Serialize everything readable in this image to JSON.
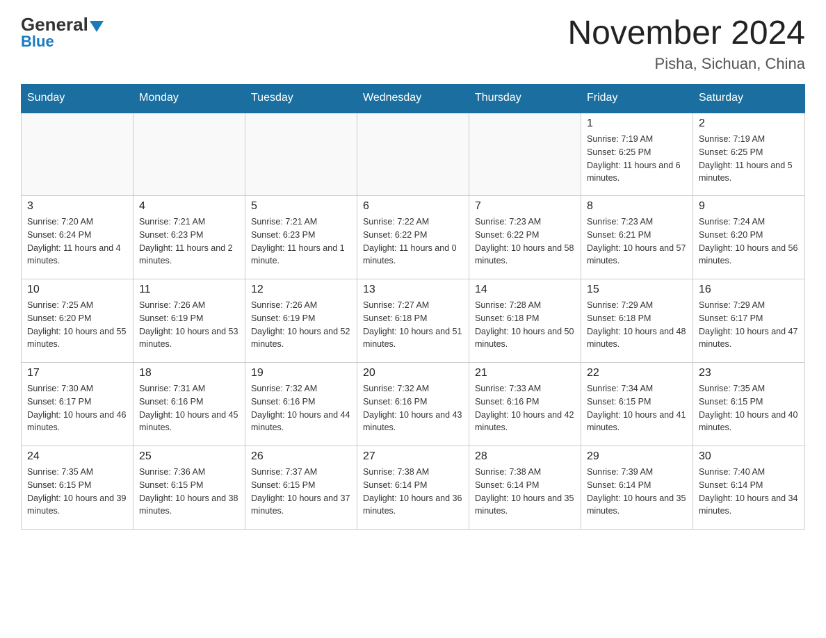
{
  "header": {
    "logo_general": "General",
    "logo_blue": "Blue",
    "title": "November 2024",
    "location": "Pisha, Sichuan, China"
  },
  "days_of_week": [
    "Sunday",
    "Monday",
    "Tuesday",
    "Wednesday",
    "Thursday",
    "Friday",
    "Saturday"
  ],
  "weeks": [
    [
      {
        "day": "",
        "info": ""
      },
      {
        "day": "",
        "info": ""
      },
      {
        "day": "",
        "info": ""
      },
      {
        "day": "",
        "info": ""
      },
      {
        "day": "",
        "info": ""
      },
      {
        "day": "1",
        "info": "Sunrise: 7:19 AM\nSunset: 6:25 PM\nDaylight: 11 hours and 6 minutes."
      },
      {
        "day": "2",
        "info": "Sunrise: 7:19 AM\nSunset: 6:25 PM\nDaylight: 11 hours and 5 minutes."
      }
    ],
    [
      {
        "day": "3",
        "info": "Sunrise: 7:20 AM\nSunset: 6:24 PM\nDaylight: 11 hours and 4 minutes."
      },
      {
        "day": "4",
        "info": "Sunrise: 7:21 AM\nSunset: 6:23 PM\nDaylight: 11 hours and 2 minutes."
      },
      {
        "day": "5",
        "info": "Sunrise: 7:21 AM\nSunset: 6:23 PM\nDaylight: 11 hours and 1 minute."
      },
      {
        "day": "6",
        "info": "Sunrise: 7:22 AM\nSunset: 6:22 PM\nDaylight: 11 hours and 0 minutes."
      },
      {
        "day": "7",
        "info": "Sunrise: 7:23 AM\nSunset: 6:22 PM\nDaylight: 10 hours and 58 minutes."
      },
      {
        "day": "8",
        "info": "Sunrise: 7:23 AM\nSunset: 6:21 PM\nDaylight: 10 hours and 57 minutes."
      },
      {
        "day": "9",
        "info": "Sunrise: 7:24 AM\nSunset: 6:20 PM\nDaylight: 10 hours and 56 minutes."
      }
    ],
    [
      {
        "day": "10",
        "info": "Sunrise: 7:25 AM\nSunset: 6:20 PM\nDaylight: 10 hours and 55 minutes."
      },
      {
        "day": "11",
        "info": "Sunrise: 7:26 AM\nSunset: 6:19 PM\nDaylight: 10 hours and 53 minutes."
      },
      {
        "day": "12",
        "info": "Sunrise: 7:26 AM\nSunset: 6:19 PM\nDaylight: 10 hours and 52 minutes."
      },
      {
        "day": "13",
        "info": "Sunrise: 7:27 AM\nSunset: 6:18 PM\nDaylight: 10 hours and 51 minutes."
      },
      {
        "day": "14",
        "info": "Sunrise: 7:28 AM\nSunset: 6:18 PM\nDaylight: 10 hours and 50 minutes."
      },
      {
        "day": "15",
        "info": "Sunrise: 7:29 AM\nSunset: 6:18 PM\nDaylight: 10 hours and 48 minutes."
      },
      {
        "day": "16",
        "info": "Sunrise: 7:29 AM\nSunset: 6:17 PM\nDaylight: 10 hours and 47 minutes."
      }
    ],
    [
      {
        "day": "17",
        "info": "Sunrise: 7:30 AM\nSunset: 6:17 PM\nDaylight: 10 hours and 46 minutes."
      },
      {
        "day": "18",
        "info": "Sunrise: 7:31 AM\nSunset: 6:16 PM\nDaylight: 10 hours and 45 minutes."
      },
      {
        "day": "19",
        "info": "Sunrise: 7:32 AM\nSunset: 6:16 PM\nDaylight: 10 hours and 44 minutes."
      },
      {
        "day": "20",
        "info": "Sunrise: 7:32 AM\nSunset: 6:16 PM\nDaylight: 10 hours and 43 minutes."
      },
      {
        "day": "21",
        "info": "Sunrise: 7:33 AM\nSunset: 6:16 PM\nDaylight: 10 hours and 42 minutes."
      },
      {
        "day": "22",
        "info": "Sunrise: 7:34 AM\nSunset: 6:15 PM\nDaylight: 10 hours and 41 minutes."
      },
      {
        "day": "23",
        "info": "Sunrise: 7:35 AM\nSunset: 6:15 PM\nDaylight: 10 hours and 40 minutes."
      }
    ],
    [
      {
        "day": "24",
        "info": "Sunrise: 7:35 AM\nSunset: 6:15 PM\nDaylight: 10 hours and 39 minutes."
      },
      {
        "day": "25",
        "info": "Sunrise: 7:36 AM\nSunset: 6:15 PM\nDaylight: 10 hours and 38 minutes."
      },
      {
        "day": "26",
        "info": "Sunrise: 7:37 AM\nSunset: 6:15 PM\nDaylight: 10 hours and 37 minutes."
      },
      {
        "day": "27",
        "info": "Sunrise: 7:38 AM\nSunset: 6:14 PM\nDaylight: 10 hours and 36 minutes."
      },
      {
        "day": "28",
        "info": "Sunrise: 7:38 AM\nSunset: 6:14 PM\nDaylight: 10 hours and 35 minutes."
      },
      {
        "day": "29",
        "info": "Sunrise: 7:39 AM\nSunset: 6:14 PM\nDaylight: 10 hours and 35 minutes."
      },
      {
        "day": "30",
        "info": "Sunrise: 7:40 AM\nSunset: 6:14 PM\nDaylight: 10 hours and 34 minutes."
      }
    ]
  ]
}
